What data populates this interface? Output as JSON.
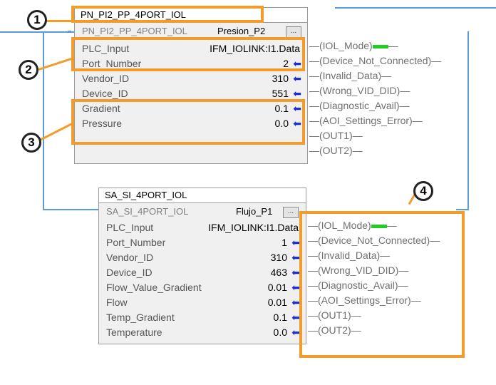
{
  "block1": {
    "title": "PN_PI2_PP_4PORT_IOL",
    "type_label": "PN_PI2_PP_4PORT_IOL",
    "tag_name": "Presion_P2",
    "ellipsis": "...",
    "params": [
      {
        "label": "PLC_Input",
        "value": "IFM_IOLINK:I1.Data",
        "arrow": false
      },
      {
        "label": "Port_Number",
        "value": "2",
        "arrow": true
      },
      {
        "label": "Vendor_ID",
        "value": "310",
        "arrow": true
      },
      {
        "label": "Device_ID",
        "value": "551",
        "arrow": true
      },
      {
        "label": "Gradient",
        "value": "0.1",
        "arrow": true
      },
      {
        "label": "Pressure",
        "value": "0.0",
        "arrow": true
      }
    ],
    "outputs": [
      "(IOL_Mode)",
      "(Device_Not_Connected)",
      "(Invalid_Data)",
      "(Wrong_VID_DID)",
      "(Diagnostic_Avail)",
      "(AOI_Settings_Error)",
      "(OUT1)",
      "(OUT2)"
    ]
  },
  "block2": {
    "title": "SA_SI_4PORT_IOL",
    "type_label": "SA_SI_4PORT_IOL",
    "tag_name": "Flujo_P1",
    "ellipsis": "...",
    "params": [
      {
        "label": "PLC_Input",
        "value": "IFM_IOLINK:I1.Data",
        "arrow": false
      },
      {
        "label": "Port_Number",
        "value": "1",
        "arrow": true
      },
      {
        "label": "Vendor_ID",
        "value": "310",
        "arrow": true
      },
      {
        "label": "Device_ID",
        "value": "463",
        "arrow": true
      },
      {
        "label": "Flow_Value_Gradient",
        "value": "0.01",
        "arrow": true
      },
      {
        "label": "Flow",
        "value": "0.01",
        "arrow": true
      },
      {
        "label": "Temp_Gradient",
        "value": "0.1",
        "arrow": true
      },
      {
        "label": "Temperature",
        "value": "0.0",
        "arrow": true
      }
    ],
    "outputs": [
      "(IOL_Mode)",
      "(Device_Not_Connected)",
      "(Invalid_Data)",
      "(Wrong_VID_DID)",
      "(Diagnostic_Avail)",
      "(AOI_Settings_Error)",
      "(OUT1)",
      "(OUT2)"
    ]
  },
  "arrow_glyph": "⬅",
  "badges": [
    "1",
    "2",
    "3",
    "4"
  ],
  "colors": {
    "highlight": "#f39c2b",
    "rung": "#5b9bd5",
    "active": "#22cc22",
    "arrow": "#1a2ed6"
  }
}
